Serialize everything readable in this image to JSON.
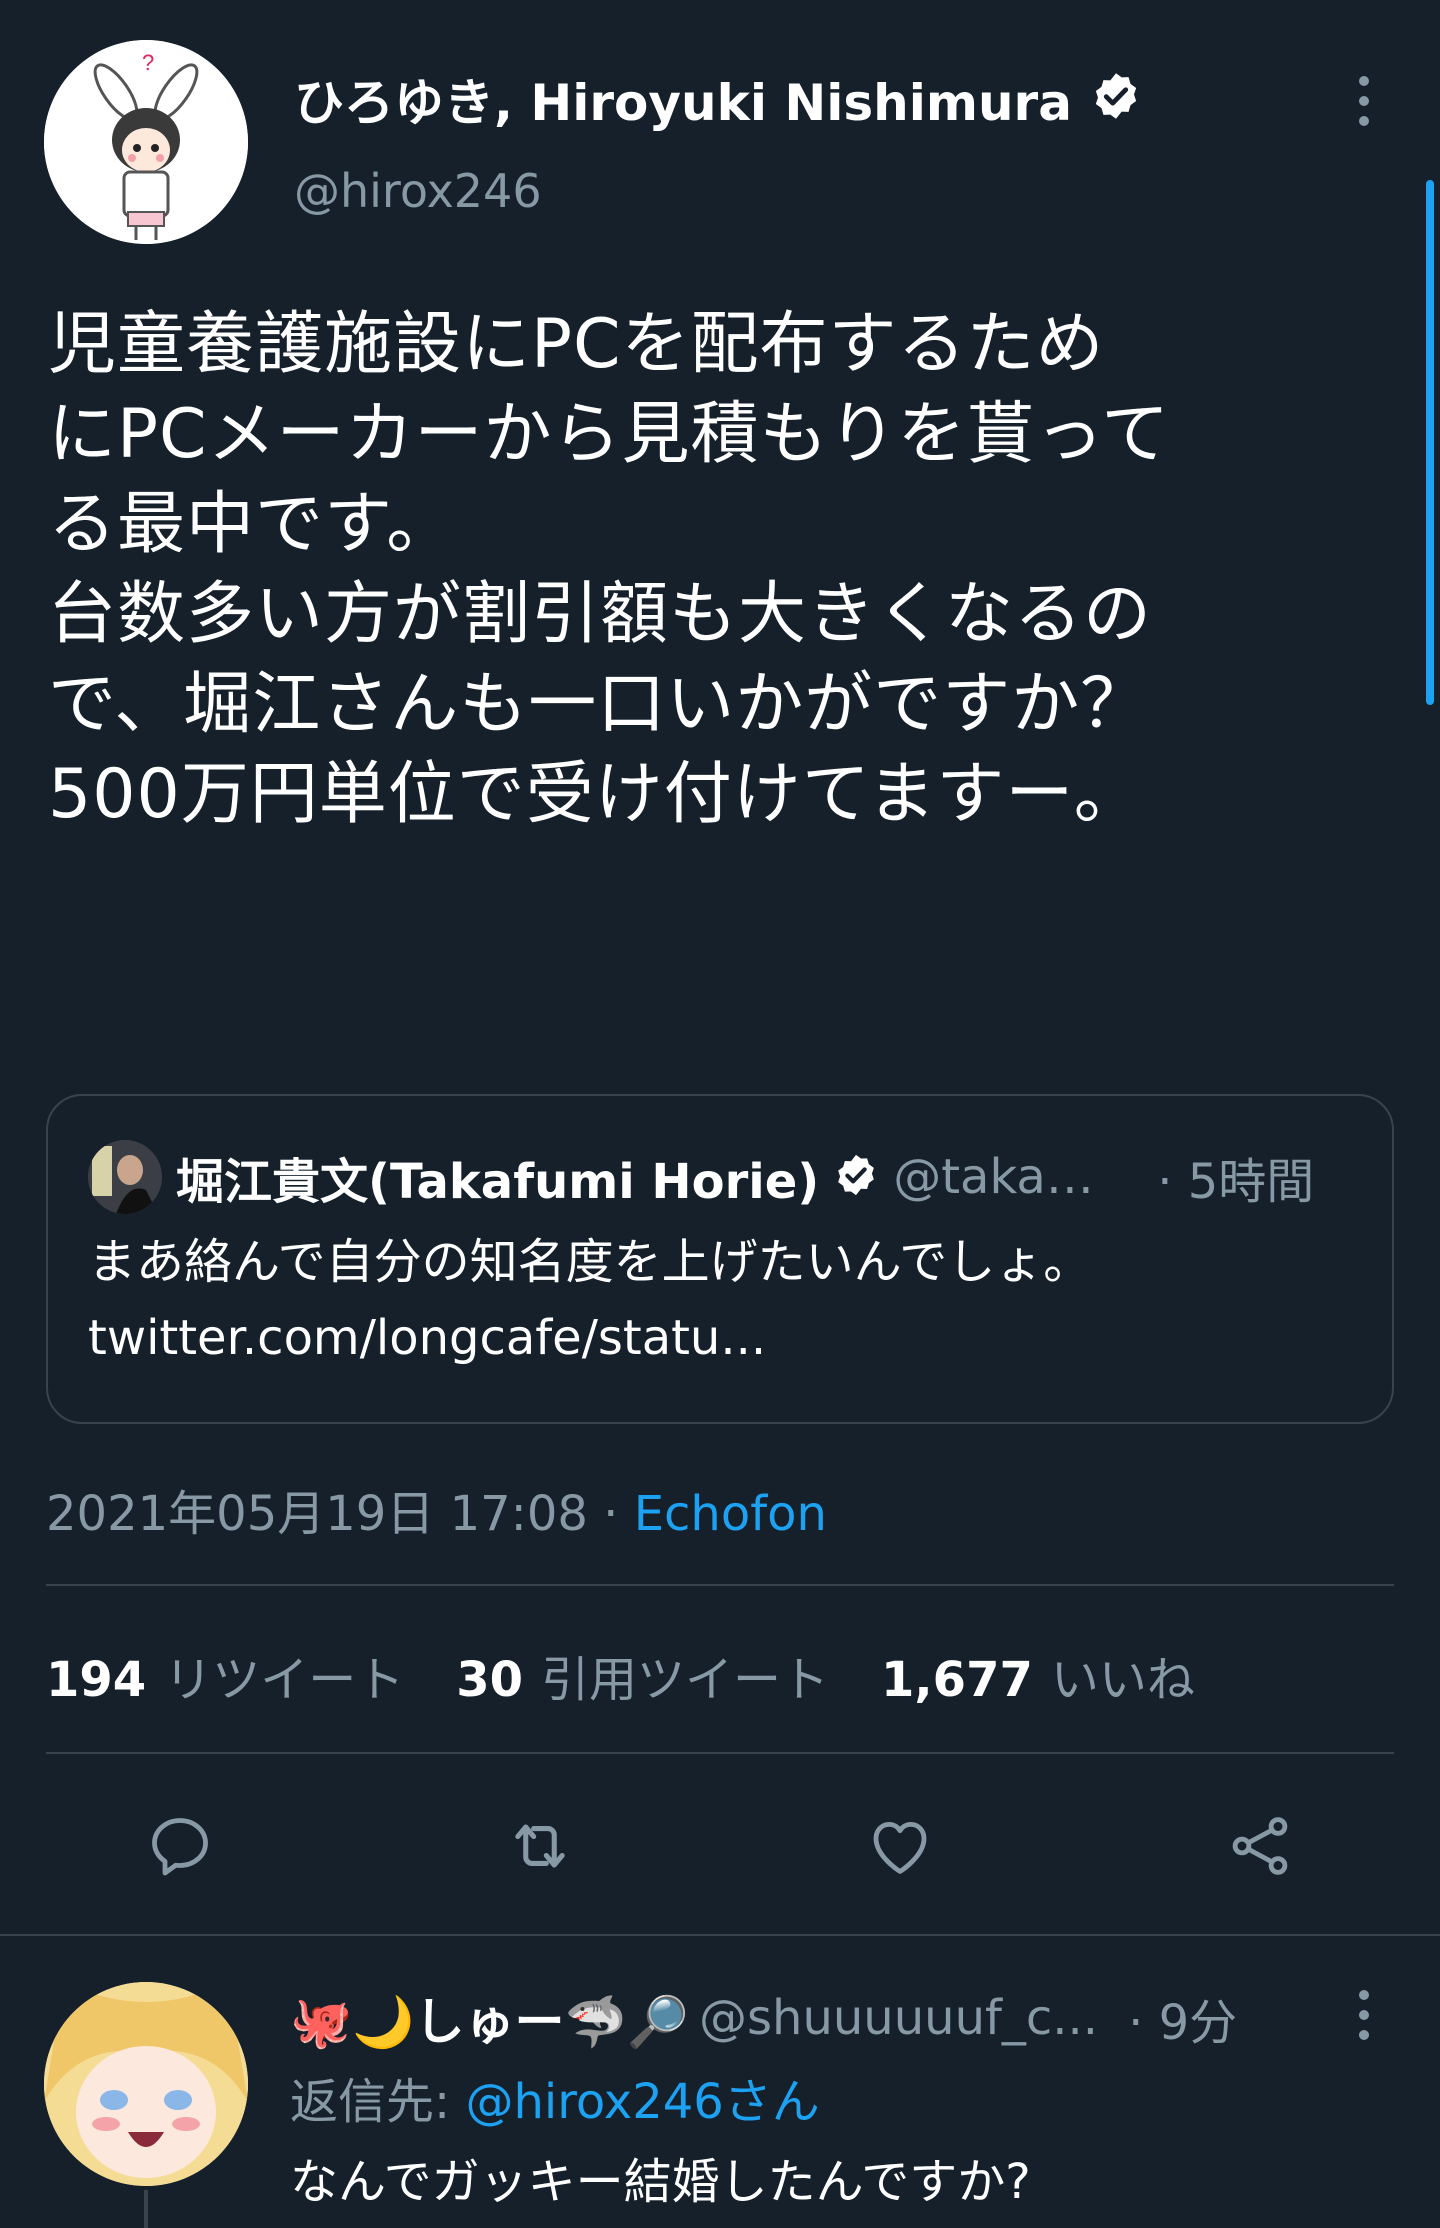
{
  "tweet": {
    "author_name": "ひろゆき, Hiroyuki Nishimura",
    "author_handle": "@hirox246",
    "avatar_question_mark": "?",
    "text": "児童養護施設にPCを配布するため\nにPCメーカーから見積もりを貰って\nる最中です。\n台数多い方が割引額も大きくなるの\nで、堀江さんも一口いかがですか？\n500万円単位で受け付けてますー。",
    "date": "2021年05月19日 17:08",
    "separator": "·",
    "client": "Echofon",
    "verified_icon": "verified-badge-icon"
  },
  "quote": {
    "author_name": "堀江貴文(Takafumi Horie)",
    "author_handle": "@takap...",
    "time": "· 5時間",
    "text": "まあ絡んで自分の知名度を上げたいんでしょ。\ntwitter.com/longcafe/statu..."
  },
  "stats": {
    "retweets_count": "194",
    "retweets_label": "リツイート",
    "quotes_count": "30",
    "quotes_label": "引用ツイート",
    "likes_count": "1,677",
    "likes_label": "いいね"
  },
  "actions": {
    "reply_icon": "reply-icon",
    "retweet_icon": "retweet-icon",
    "like_icon": "heart-icon",
    "share_icon": "share-icon"
  },
  "reply": {
    "author_name": "🐙🌙しゅー🦈🔎",
    "author_handle": "@shuuuuuuf_c...",
    "time": "· 9分",
    "reply_to_label": "返信先:",
    "reply_to_mention": "@hirox246さん",
    "text": "なんでガッキー結婚したんですか?"
  },
  "colors": {
    "background": "#15202b",
    "text_primary": "#ffffff",
    "text_secondary": "#8899a6",
    "accent": "#1da1f2",
    "border": "#38444d"
  }
}
